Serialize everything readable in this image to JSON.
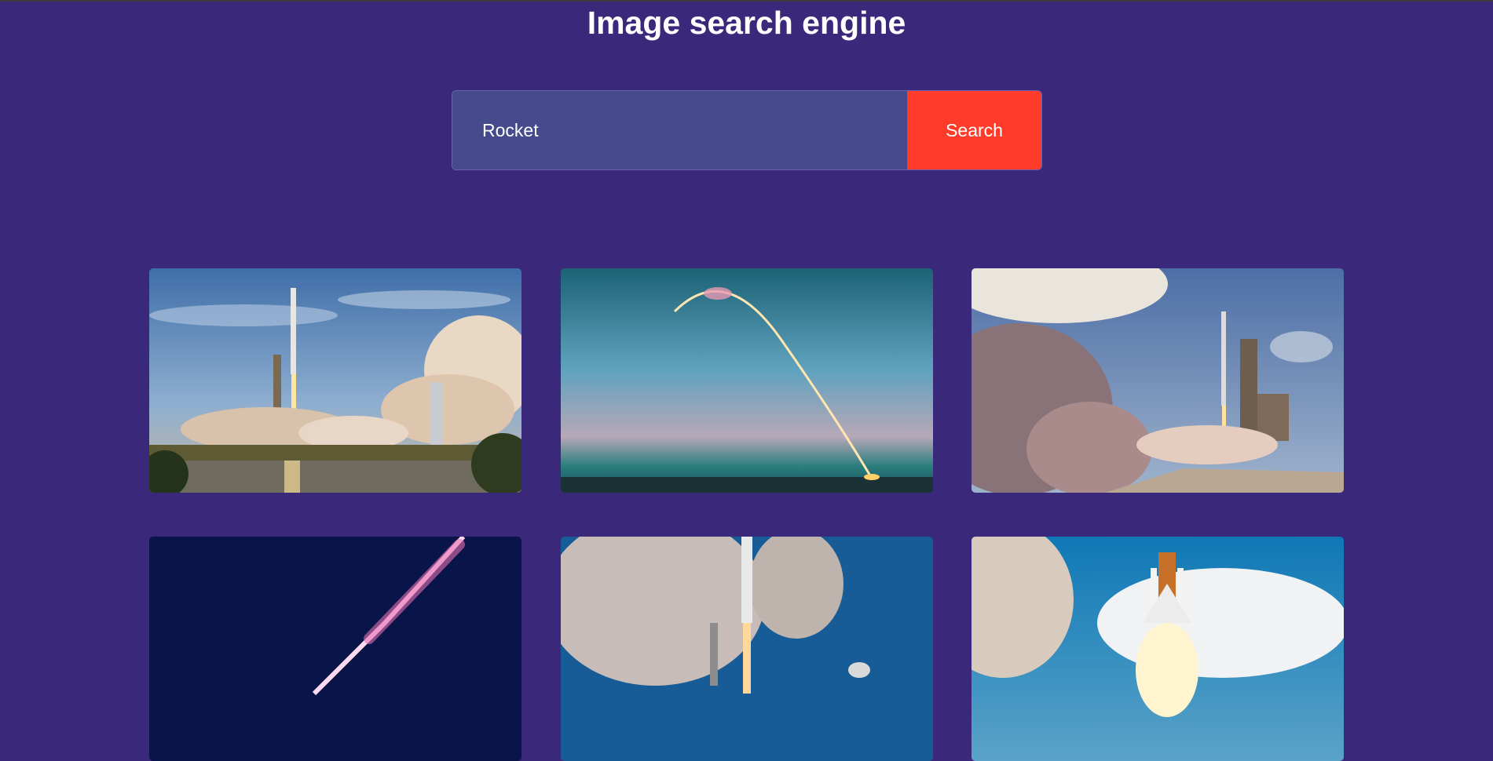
{
  "header": {
    "title": "Image search engine"
  },
  "search": {
    "value": "Rocket",
    "placeholder": "",
    "button_label": "Search"
  },
  "results": [
    {
      "subject": "rocket-launch-pad-smoke"
    },
    {
      "subject": "rocket-arc-trail-dusk"
    },
    {
      "subject": "rocket-launch-tower-clouds"
    },
    {
      "subject": "rocket-streak-night"
    },
    {
      "subject": "heavy-rocket-smoke-plume"
    },
    {
      "subject": "space-shuttle-liftoff"
    }
  ],
  "colors": {
    "background": "#3a287b",
    "input_bg": "#454a8c",
    "button_bg": "#ff3b2a",
    "text": "#ffffff"
  }
}
